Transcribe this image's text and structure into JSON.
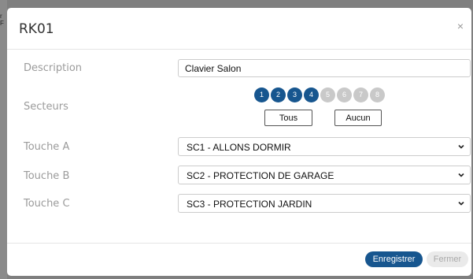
{
  "backdrop": {
    "fragment": "r\nF"
  },
  "modal": {
    "title": "RK01",
    "close_icon": "×",
    "description": {
      "label": "Description",
      "value": "Clavier Salon"
    },
    "sectors": {
      "label": "Secteurs",
      "items": [
        {
          "num": "1",
          "active": true
        },
        {
          "num": "2",
          "active": true
        },
        {
          "num": "3",
          "active": true
        },
        {
          "num": "4",
          "active": true
        },
        {
          "num": "5",
          "active": false
        },
        {
          "num": "6",
          "active": false
        },
        {
          "num": "7",
          "active": false
        },
        {
          "num": "8",
          "active": false
        }
      ],
      "all_label": "Tous",
      "none_label": "Aucun"
    },
    "touche_a": {
      "label": "Touche A",
      "value": "SC1 - ALLONS DORMIR"
    },
    "touche_b": {
      "label": "Touche B",
      "value": "SC2 - PROTECTION DE GARAGE"
    },
    "touche_c": {
      "label": "Touche C",
      "value": "SC3 - PROTECTION JARDIN"
    },
    "footer": {
      "save_label": "Enregistrer",
      "close_label": "Fermer"
    }
  },
  "colors": {
    "accent": "#17568f",
    "inactive": "#c9c9c9"
  },
  "icons": {
    "close": "close-icon",
    "select": "chevron-down-icon"
  }
}
